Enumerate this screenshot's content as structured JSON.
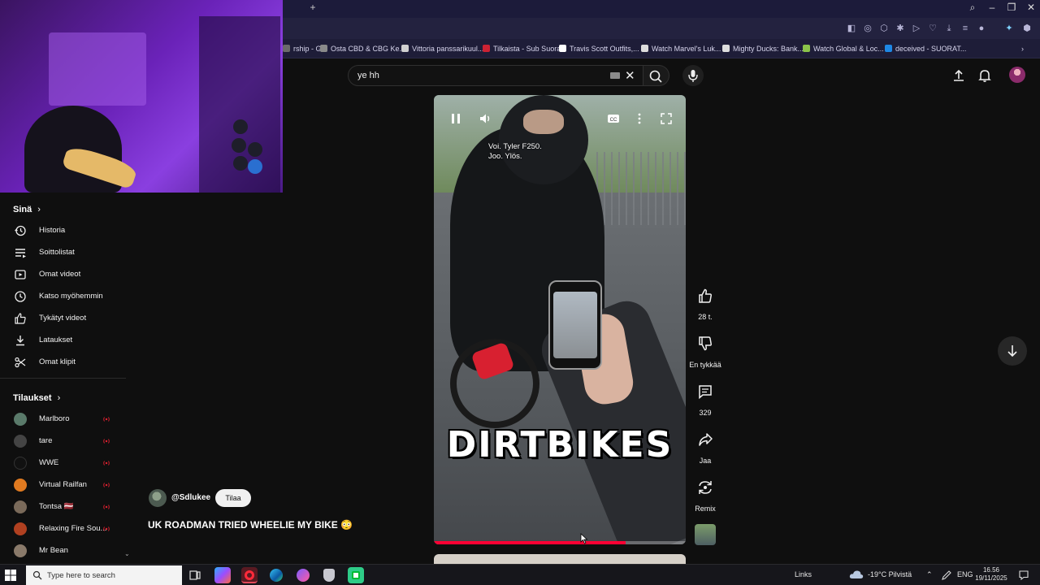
{
  "browser": {
    "bookmarks": [
      {
        "label": "rship - G...",
        "color": "#6b6b6b"
      },
      {
        "label": "Osta CBD & CBG Ke...",
        "color": "#8a8a8a"
      },
      {
        "label": "Vittoria panssarikuul...",
        "color": "#d0d0d0"
      },
      {
        "label": "Tilkaista - Sub Suora",
        "color": "#cc2233"
      },
      {
        "label": "Travis Scott Outfits,...",
        "color": "#ffffff"
      },
      {
        "label": "Watch Marvel's Luk...",
        "color": "#dddddd"
      },
      {
        "label": "Mighty Ducks: Bank...",
        "color": "#dddddd"
      },
      {
        "label": "Watch Global & Loc...",
        "color": "#8bc34a"
      },
      {
        "label": "deceived - SUORAT...",
        "color": "#1e88e5"
      }
    ]
  },
  "header": {
    "search_value": "ye hh"
  },
  "sidebar": {
    "you_title": "Sinä",
    "items": [
      {
        "label": "Historia",
        "icon": "history-icon"
      },
      {
        "label": "Soittolistat",
        "icon": "playlists-icon"
      },
      {
        "label": "Omat videot",
        "icon": "your-videos-icon"
      },
      {
        "label": "Katso myöhemmin",
        "icon": "watch-later-icon"
      },
      {
        "label": "Tykätyt videot",
        "icon": "liked-videos-icon"
      },
      {
        "label": "Lataukset",
        "icon": "downloads-icon"
      },
      {
        "label": "Omat klipit",
        "icon": "clips-icon"
      }
    ],
    "subs_title": "Tilaukset",
    "subscriptions": [
      {
        "label": "Marlboro",
        "color": "#5a7a6a"
      },
      {
        "label": "tare",
        "color": "#444444"
      },
      {
        "label": "WWE",
        "color": "#111111"
      },
      {
        "label": "Virtual Railfan",
        "color": "#e07a20"
      },
      {
        "label": "Tontsa 🇱🇻",
        "color": "#7a6a5a"
      },
      {
        "label": "Relaxing Fire Sou...",
        "color": "#b04020"
      },
      {
        "label": "Mr Bean",
        "color": "#8a7a6a"
      }
    ]
  },
  "video": {
    "caption_line1": "Voi. Tyler F250.",
    "caption_line2": "Joo. Ylös.",
    "overlay_title": "DIRTBIKES",
    "progress": 0.76
  },
  "channel": {
    "handle": "@Sdlukee",
    "subscribe_label": "Tilaa",
    "title": "UK ROADMAN TRIED WHEELIE MY BIKE 😳"
  },
  "actions": {
    "like_count": "28 t.",
    "dislike_label": "En tykkää",
    "comment_count": "329",
    "share_label": "Jaa",
    "remix_label": "Remix"
  },
  "taskbar": {
    "search_placeholder": "Type here to search",
    "links_label": "Links",
    "weather": "-19°C Pilvistä",
    "lang": "ENG",
    "time": "16.56",
    "date": "19/11/2025"
  }
}
